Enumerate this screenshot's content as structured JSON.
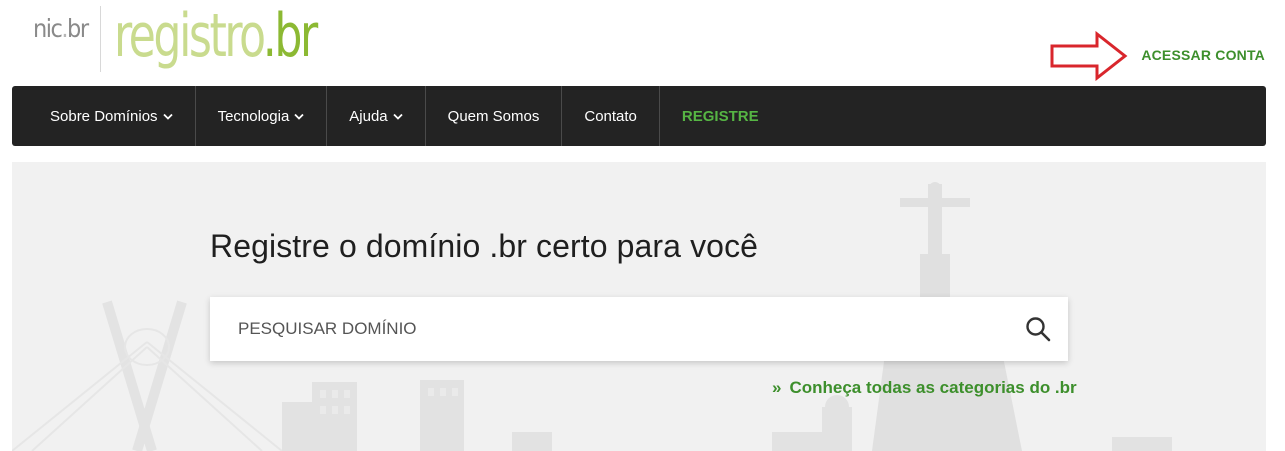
{
  "header": {
    "nic_logo_prefix": "nic",
    "nic_logo_dot": ".",
    "nic_logo_suffix": "br",
    "logo_main": "registro",
    "logo_suffix": ".br",
    "account_link": "ACESSAR CONTA"
  },
  "nav": {
    "items": [
      {
        "label": "Sobre Domínios",
        "has_dropdown": true
      },
      {
        "label": "Tecnologia",
        "has_dropdown": true
      },
      {
        "label": "Ajuda",
        "has_dropdown": true
      },
      {
        "label": "Quem Somos",
        "has_dropdown": false
      },
      {
        "label": "Contato",
        "has_dropdown": false
      },
      {
        "label": "REGISTRE",
        "has_dropdown": false
      }
    ]
  },
  "hero": {
    "title": "Registre o domínio .br certo para você",
    "search_placeholder": "PESQUISAR DOMÍNIO",
    "categories_prefix": "»",
    "categories_link": "Conheça todas as categorias do .br"
  },
  "icons": {
    "search": "search-icon",
    "dropdown": "chevron-down-icon",
    "annotation": "red-arrow-icon"
  },
  "colors": {
    "brand_green": "#3d8f2c",
    "logo_green_light": "#c9db8e",
    "logo_green_dark": "#8cb933",
    "nav_bg": "#232323",
    "register_green": "#56b544",
    "annotation_red": "#d9262c"
  }
}
